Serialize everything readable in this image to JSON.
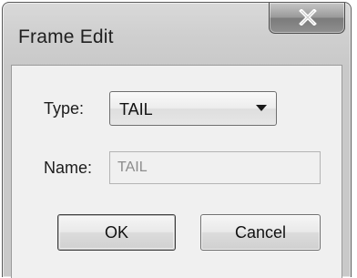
{
  "window": {
    "title": "Frame Edit",
    "close_icon": "close-icon"
  },
  "form": {
    "type_label": "Type:",
    "type_value": "TAIL",
    "name_label": "Name:",
    "name_value": "TAIL"
  },
  "buttons": {
    "ok_label": "OK",
    "cancel_label": "Cancel"
  }
}
